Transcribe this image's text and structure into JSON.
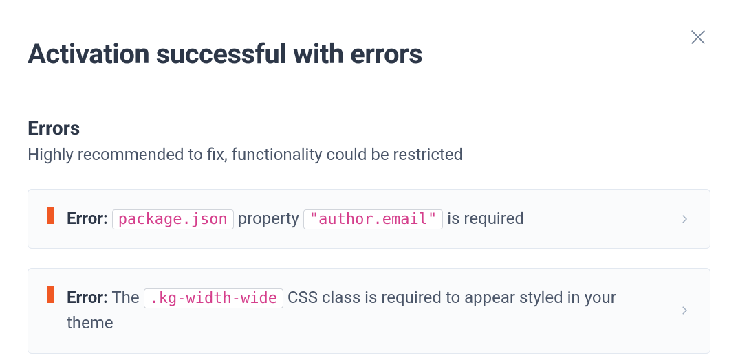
{
  "modal": {
    "title": "Activation successful with errors",
    "section_title": "Errors",
    "section_subtitle": "Highly recommended to fix, functionality could be restricted"
  },
  "errors": [
    {
      "label": "Error:",
      "parts": [
        {
          "type": "text",
          "value": ""
        },
        {
          "type": "code",
          "value": "package.json"
        },
        {
          "type": "text",
          "value": " property "
        },
        {
          "type": "code",
          "value": "\"author.email\""
        },
        {
          "type": "text",
          "value": " is required"
        }
      ]
    },
    {
      "label": "Error:",
      "parts": [
        {
          "type": "text",
          "value": "The "
        },
        {
          "type": "code",
          "value": ".kg-width-wide"
        },
        {
          "type": "text",
          "value": " CSS class is required to appear styled in your theme"
        }
      ]
    }
  ],
  "colors": {
    "error_marker": "#f05924",
    "code_text": "#d53f8c"
  }
}
